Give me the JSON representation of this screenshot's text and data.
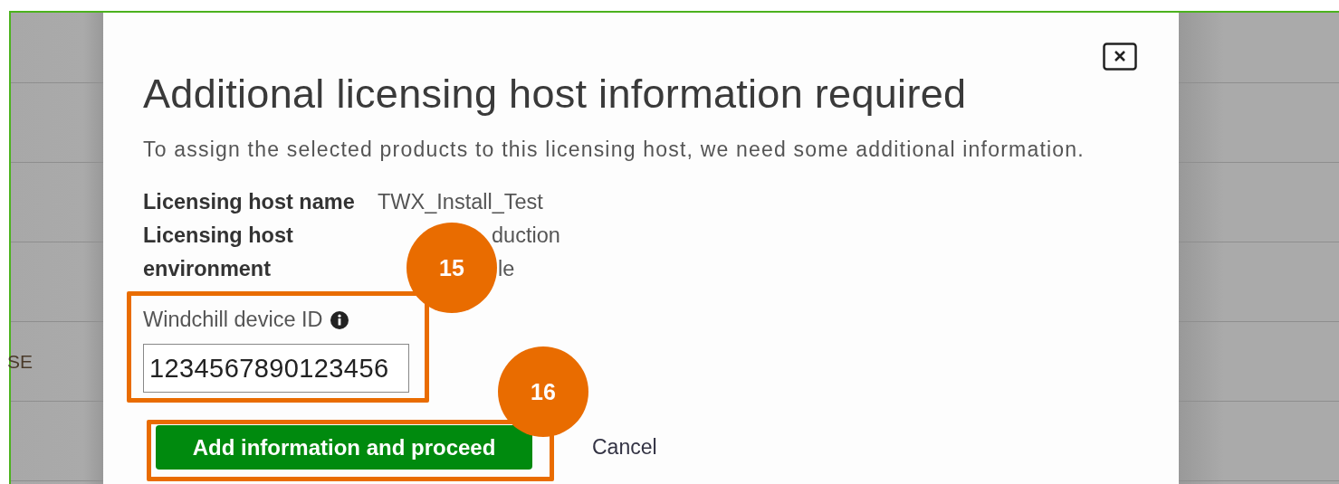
{
  "background": {
    "cell_text": "SE"
  },
  "dialog": {
    "title": "Additional licensing host information required",
    "description": "To assign the selected products to this licensing host, we need some additional information.",
    "details": [
      {
        "label": "Licensing host name",
        "values": [
          "TWX_Install_Test"
        ]
      },
      {
        "label": "Licensing host environment",
        "values": [
          "duction",
          "le"
        ]
      }
    ],
    "field": {
      "label": "Windchill device ID",
      "value": "1234567890123456"
    },
    "primary_button": "Add information and proceed",
    "cancel_button": "Cancel"
  },
  "annotations": [
    {
      "number": "15"
    },
    {
      "number": "16"
    }
  ]
}
